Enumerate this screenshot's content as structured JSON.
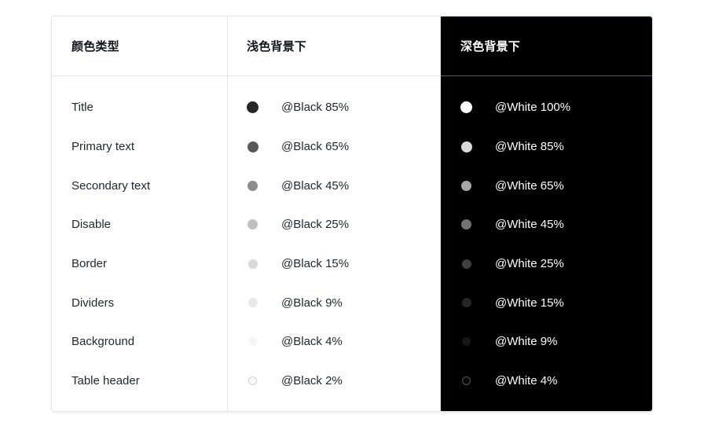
{
  "table": {
    "headers": {
      "type": "颜色类型",
      "light": "浅色背景下",
      "dark": "深色背景下"
    },
    "rows": [
      {
        "name": "Title",
        "light": {
          "label": "@Black 85%",
          "swatch": "black-85-swatch",
          "color": "#000000",
          "opacity": 0.85,
          "size": 15
        },
        "dark": {
          "label": "@White 100%",
          "swatch": "white-100-swatch",
          "color": "#ffffff",
          "opacity": 1.0,
          "size": 15
        }
      },
      {
        "name": "Primary text",
        "light": {
          "label": "@Black 65%",
          "swatch": "black-65-swatch",
          "color": "#000000",
          "opacity": 0.65,
          "size": 14
        },
        "dark": {
          "label": "@White 85%",
          "swatch": "white-85-swatch",
          "color": "#ffffff",
          "opacity": 0.85,
          "size": 14
        }
      },
      {
        "name": "Secondary text",
        "light": {
          "label": "@Black 45%",
          "swatch": "black-45-swatch",
          "color": "#000000",
          "opacity": 0.45,
          "size": 13
        },
        "dark": {
          "label": "@White 65%",
          "swatch": "white-65-swatch",
          "color": "#ffffff",
          "opacity": 0.65,
          "size": 13
        }
      },
      {
        "name": "Disable",
        "light": {
          "label": "@Black 25%",
          "swatch": "black-25-swatch",
          "color": "#000000",
          "opacity": 0.25,
          "size": 13
        },
        "dark": {
          "label": "@White 45%",
          "swatch": "white-45-swatch",
          "color": "#ffffff",
          "opacity": 0.45,
          "size": 13
        }
      },
      {
        "name": "Border",
        "light": {
          "label": "@Black 15%",
          "swatch": "black-15-swatch",
          "color": "#000000",
          "opacity": 0.15,
          "size": 12
        },
        "dark": {
          "label": "@White 25%",
          "swatch": "white-25-swatch",
          "color": "#ffffff",
          "opacity": 0.25,
          "size": 12
        }
      },
      {
        "name": "Dividers",
        "light": {
          "label": "@Black 9%",
          "swatch": "black-9-swatch",
          "color": "#000000",
          "opacity": 0.09,
          "size": 12
        },
        "dark": {
          "label": "@White 15%",
          "swatch": "white-15-swatch",
          "color": "#ffffff",
          "opacity": 0.15,
          "size": 12
        }
      },
      {
        "name": "Background",
        "light": {
          "label": "@Black 4%",
          "swatch": "black-4-swatch",
          "color": "#000000",
          "opacity": 0.04,
          "size": 11
        },
        "dark": {
          "label": "@White 9%",
          "swatch": "white-9-swatch",
          "color": "#ffffff",
          "opacity": 0.09,
          "size": 11
        }
      },
      {
        "name": "Table header",
        "light": {
          "label": "@Black 2%",
          "swatch": "black-2-swatch",
          "color": "#000000",
          "opacity": 0.02,
          "size": 11,
          "ring": true
        },
        "dark": {
          "label": "@White 4%",
          "swatch": "white-4-swatch",
          "color": "#ffffff",
          "opacity": 0.04,
          "size": 11,
          "ring": true
        }
      }
    ]
  },
  "theme": {
    "page_background": "#ffffff",
    "card_background": "#ffffff",
    "dark_panel_background": "#000000",
    "border_color": "#e1e4ea",
    "dark_divider_color": "#5a5a5a",
    "text_color": "#222831",
    "header_text_color": "#10141c",
    "dark_text_color": "#ffffff"
  }
}
